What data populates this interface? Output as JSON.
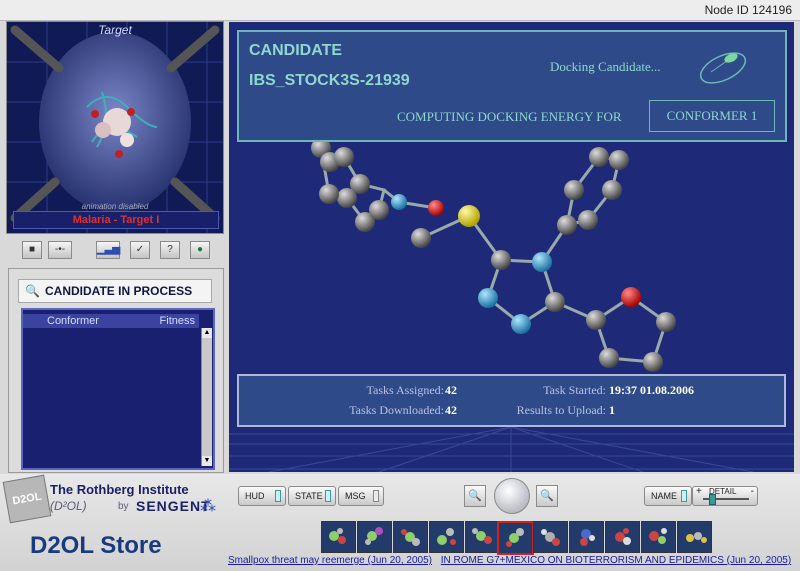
{
  "header": {
    "node_id": "Node ID 124196"
  },
  "target": {
    "title": "Target",
    "subtitle": "animation disabled",
    "name": "Malaria - Target I"
  },
  "left_toolbar": {
    "icons": [
      "stop-icon",
      "bar-chart-icon",
      "check-icon",
      "help-icon",
      "globe-icon"
    ]
  },
  "candidate_panel": {
    "title": "CANDIDATE IN PROCESS",
    "columns": [
      "Conformer",
      "Fitness"
    ],
    "rows": []
  },
  "status": {
    "candidate_label": "CANDIDATE",
    "candidate_id": "IBS_STOCK3S-21939",
    "docking_label": "Docking Candidate...",
    "computing_label": "COMPUTING DOCKING ENERGY FOR",
    "conformer": "CONFORMER 1"
  },
  "tasks": {
    "assigned_label": "Tasks Assigned:",
    "assigned_value": "42",
    "downloaded_label": "Tasks Downloaded:",
    "downloaded_value": "42",
    "started_label": "Task Started:",
    "started_value": "19:37 01.08.2006",
    "upload_label": "Results to Upload:",
    "upload_value": "1"
  },
  "brand": {
    "logo_text": "D2OL",
    "institute": "The Rothberg Institute",
    "sub": "(D²OL)",
    "by": "by",
    "company": "SENGENT",
    "store": "D2OL Store"
  },
  "toolbar": {
    "hud": "HUD",
    "state": "STATE",
    "msg": "MSG",
    "name": "NAME",
    "detail": "DETAIL",
    "detail_plus": "+",
    "detail_minus": "-"
  },
  "ticker": [
    "Smallpox threat may reemerge  (Jun 20, 2005)",
    "IN ROME G7+MEXICO ON BIOTERRORISM AND EPIDEMICS  (Jun 20, 2005)"
  ]
}
